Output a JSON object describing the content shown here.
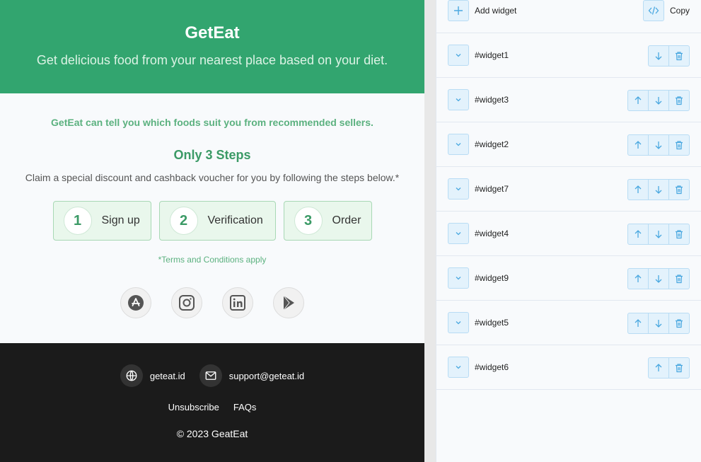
{
  "email": {
    "hero": {
      "title": "GetEat",
      "subtitle": "Get delicious food from your nearest place based on your diet."
    },
    "tagline": "GetEat can tell you which foods suit you from recommended sellers.",
    "steps_title": "Only 3 Steps",
    "steps_desc": "Claim a special discount and cashback voucher for you by following the steps below.*",
    "steps": [
      {
        "num": "1",
        "label": "Sign up"
      },
      {
        "num": "2",
        "label": "Verification"
      },
      {
        "num": "3",
        "label": "Order"
      }
    ],
    "terms": "*Terms and Conditions apply",
    "socials": [
      "app-store-icon",
      "instagram-icon",
      "linkedin-icon",
      "play-store-icon"
    ],
    "footer": {
      "website": "geteat.id",
      "email": "support@geteat.id",
      "unsubscribe": "Unsubscribe",
      "faqs": "FAQs",
      "copyright": "© 2023 GeatEat"
    }
  },
  "panel": {
    "add_widget": "Add widget",
    "copy": "Copy",
    "widgets": [
      {
        "id": "#widget1",
        "up": false,
        "down": true
      },
      {
        "id": "#widget3",
        "up": true,
        "down": true
      },
      {
        "id": "#widget2",
        "up": true,
        "down": true
      },
      {
        "id": "#widget7",
        "up": true,
        "down": true
      },
      {
        "id": "#widget4",
        "up": true,
        "down": true
      },
      {
        "id": "#widget9",
        "up": true,
        "down": true
      },
      {
        "id": "#widget5",
        "up": true,
        "down": true
      },
      {
        "id": "#widget6",
        "up": true,
        "down": false
      }
    ]
  },
  "colors": {
    "brand_green": "#32a56f",
    "accent_blue": "#4aa8e0",
    "footer_bg": "#1b1b1b"
  }
}
